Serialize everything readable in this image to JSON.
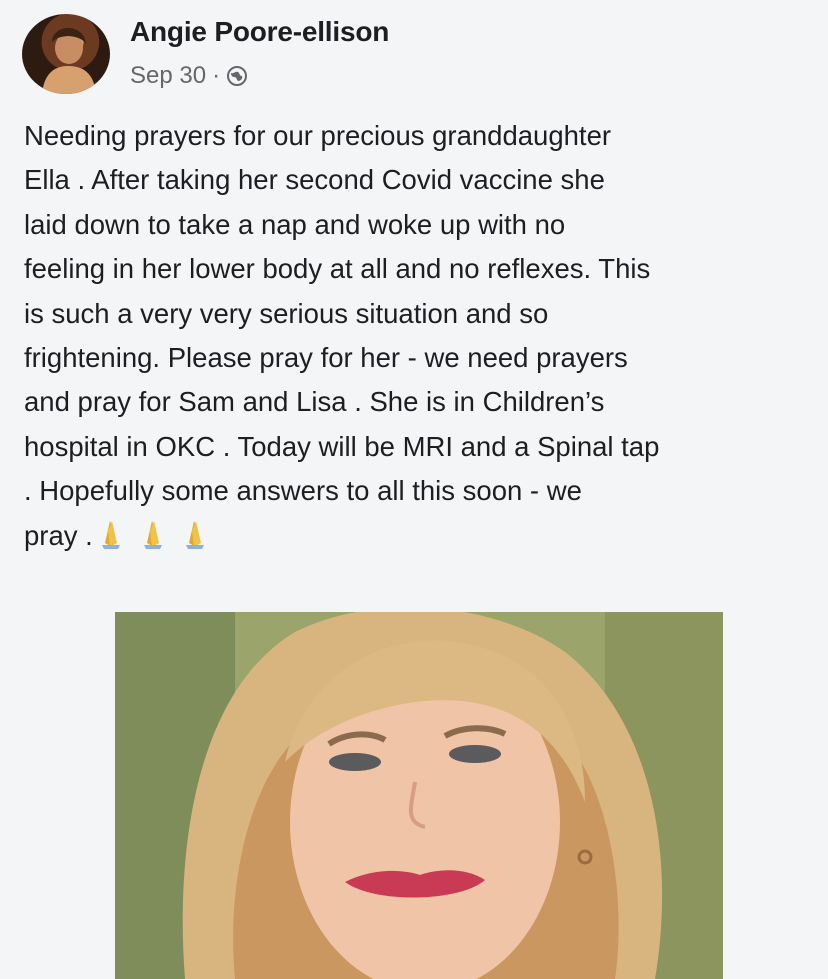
{
  "post": {
    "author": "Angie Poore-ellison",
    "date": "Sep 30",
    "separator": "·",
    "privacy_icon": "globe-icon",
    "text": "Needing prayers for our precious granddaughter\nElla . After taking her second Covid vaccine she\nlaid down to take a nap and woke up with no\nfeeling in her lower body at all and no reflexes. This\nis such a very very serious situation and so\nfrightening. Please  pray for her - we need prayers\nand pray for Sam and Lisa . She is in Children’s\nhospital in OKC . Today will be MRI and a Spinal tap\n. Hopefully some answers to all this soon - we\npray . ",
    "emoji": [
      "praying-hands-icon",
      "praying-hands-icon",
      "praying-hands-icon"
    ]
  },
  "colors": {
    "background": "#f4f5f7",
    "text": "#1c1e21",
    "meta_text": "#65676b"
  }
}
